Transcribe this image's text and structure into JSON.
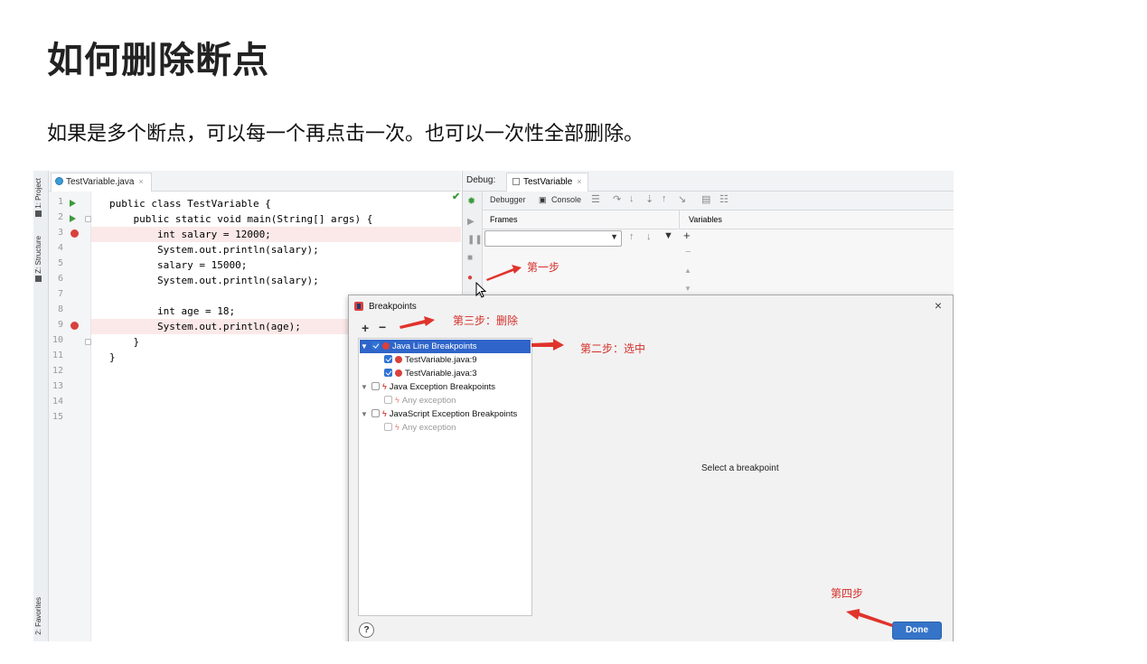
{
  "slide": {
    "title": "如何删除断点",
    "subtitle": "如果是多个断点，可以每一个再点击一次。也可以一次性全部删除。"
  },
  "ide": {
    "left_tabs": [
      "1: Project",
      "Z: Structure",
      "2: Favorites"
    ],
    "editor_tab": "TestVariable.java",
    "editor_tab_close": "×",
    "code_lines": [
      {
        "n": "1",
        "text": "public class TestVariable {",
        "marker": "run",
        "hl": false
      },
      {
        "n": "2",
        "text": "    public static void main(String[] args) {",
        "marker": "run",
        "hl": false
      },
      {
        "n": "3",
        "text": "        int salary = 12000;",
        "marker": "bp",
        "hl": true
      },
      {
        "n": "4",
        "text": "        System.out.println(salary);",
        "marker": "",
        "hl": false
      },
      {
        "n": "5",
        "text": "        salary = 15000;",
        "marker": "",
        "hl": false
      },
      {
        "n": "6",
        "text": "        System.out.println(salary);",
        "marker": "",
        "hl": false
      },
      {
        "n": "7",
        "text": "",
        "marker": "",
        "hl": false
      },
      {
        "n": "8",
        "text": "        int age = 18;",
        "marker": "",
        "hl": false
      },
      {
        "n": "9",
        "text": "        System.out.println(age);",
        "marker": "bp",
        "hl": true
      },
      {
        "n": "10",
        "text": "    }",
        "marker": "",
        "hl": false
      },
      {
        "n": "11",
        "text": "}",
        "marker": "",
        "hl": false
      },
      {
        "n": "12",
        "text": "",
        "marker": "",
        "hl": false
      },
      {
        "n": "13",
        "text": "",
        "marker": "",
        "hl": false
      },
      {
        "n": "14",
        "text": "",
        "marker": "",
        "hl": false
      },
      {
        "n": "15",
        "text": "",
        "marker": "",
        "hl": false
      }
    ],
    "debug_label": "Debug:",
    "debug_tab": "TestVariable",
    "debug_tab_close": "×",
    "toolbar": {
      "debugger": "Debugger",
      "console": "Console"
    },
    "frames_label": "Frames",
    "variables_label": "Variables"
  },
  "dialog": {
    "title": "Breakpoints",
    "close": "×",
    "add": "+",
    "remove": "−",
    "tree": [
      {
        "label": "Java Line Breakpoints",
        "level": 0,
        "checked": true,
        "selected": true,
        "icon": "dot",
        "twisty": "▼"
      },
      {
        "label": "TestVariable.java:9",
        "level": 1,
        "checked": true,
        "selected": false,
        "icon": "dot",
        "twisty": ""
      },
      {
        "label": "TestVariable.java:3",
        "level": 1,
        "checked": true,
        "selected": false,
        "icon": "dot",
        "twisty": ""
      },
      {
        "label": "Java Exception Breakpoints",
        "level": 0,
        "checked": false,
        "selected": false,
        "icon": "bolt",
        "twisty": "▼"
      },
      {
        "label": "Any exception",
        "level": 1,
        "checked": false,
        "selected": false,
        "icon": "bolt",
        "twisty": "",
        "dim": true
      },
      {
        "label": "JavaScript Exception Breakpoints",
        "level": 0,
        "checked": false,
        "selected": false,
        "icon": "bolt",
        "twisty": "▼"
      },
      {
        "label": "Any exception",
        "level": 1,
        "checked": false,
        "selected": false,
        "icon": "bolt",
        "twisty": "",
        "dim": true
      }
    ],
    "placeholder": "Select a breakpoint",
    "help": "?",
    "done": "Done"
  },
  "annotations": {
    "step1": "第一步",
    "step2": "第二步：选中",
    "step3": "第三步：删除",
    "step4": "第四步"
  },
  "colors": {
    "annotation": "#d4302a",
    "selection": "#2f65ca",
    "breakpoint": "#d9413c",
    "done_button": "#3574c8"
  }
}
